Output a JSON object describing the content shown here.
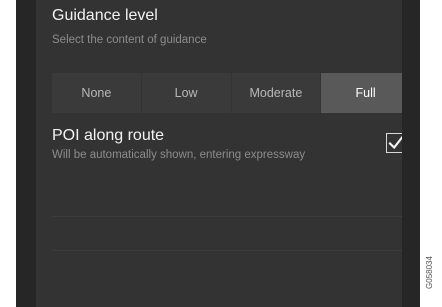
{
  "guidance": {
    "title": "Guidance level",
    "subtitle": "Select the content of guidance",
    "options": [
      "None",
      "Low",
      "Moderate",
      "Full"
    ],
    "selected": "Full"
  },
  "poi": {
    "title": "POI along route",
    "subtitle": "Will be automatically shown, entering expressway",
    "checked": true
  },
  "figure_id": "G058034"
}
